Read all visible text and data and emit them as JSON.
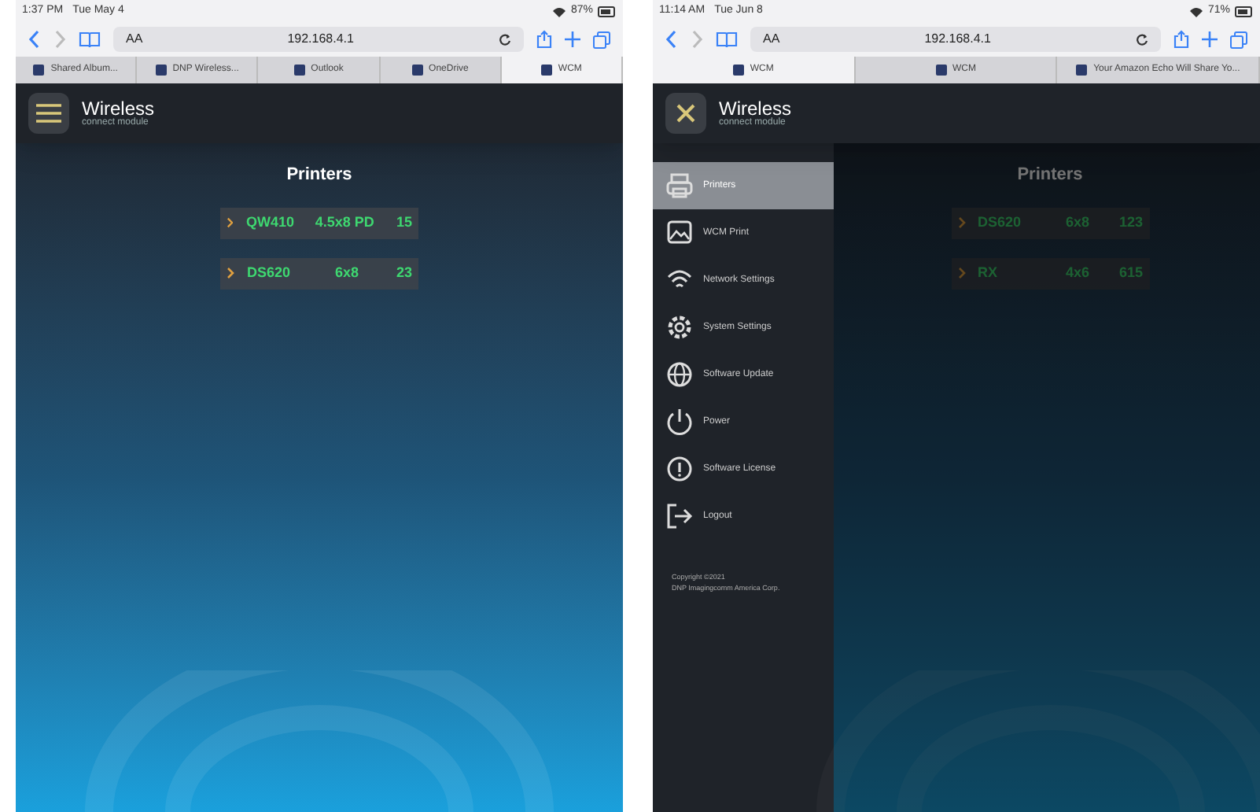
{
  "screens": [
    {
      "status_bar": {
        "time": "1:37 PM",
        "date": "Tue May 4",
        "battery": "87%"
      },
      "address_bar": {
        "text_size": "AA",
        "url": "192.168.4.1"
      },
      "tabs": [
        {
          "label": "Shared Album...",
          "selected": false
        },
        {
          "label": "DNP Wireless...",
          "selected": false
        },
        {
          "label": "Outlook",
          "selected": false
        },
        {
          "label": "OneDrive",
          "selected": false
        },
        {
          "label": "WCM",
          "selected": true
        }
      ],
      "header": {
        "logo": "Wireless",
        "logo_subtitle": "connect module",
        "menu_open": false
      },
      "title": "Printers",
      "printers": [
        {
          "model": "QW410",
          "size": "4.5x8 PD",
          "count": "15"
        },
        {
          "model": "DS620",
          "size": "6x8",
          "count": "23"
        }
      ]
    },
    {
      "status_bar": {
        "time": "11:14 AM",
        "date": "Tue Jun 8",
        "battery": "71%"
      },
      "address_bar": {
        "text_size": "AA",
        "url": "192.168.4.1"
      },
      "tabs": [
        {
          "label": "WCM",
          "selected": true
        },
        {
          "label": "WCM",
          "selected": false
        },
        {
          "label": "Your Amazon Echo Will Share Yo...",
          "selected": false
        }
      ],
      "header": {
        "logo": "Wireless",
        "logo_subtitle": "connect module",
        "menu_open": true
      },
      "title": "Printers",
      "printers": [
        {
          "model": "DS620",
          "size": "6x8",
          "count": "123"
        },
        {
          "model": "RX",
          "size": "4x6",
          "count": "615"
        }
      ],
      "sidebar": {
        "items": [
          {
            "label": "Printers",
            "kind": "printer",
            "selected": true
          },
          {
            "label": "WCM Print",
            "kind": "photo",
            "selected": false
          },
          {
            "label": "Network Settings",
            "kind": "wifi",
            "selected": false
          },
          {
            "label": "System Settings",
            "kind": "gear",
            "selected": false
          },
          {
            "label": "Software Update",
            "kind": "globe",
            "selected": false
          },
          {
            "label": "Power",
            "kind": "power",
            "selected": false
          },
          {
            "label": "Software License",
            "kind": "info",
            "selected": false
          },
          {
            "label": "Logout",
            "kind": "logout",
            "selected": false
          }
        ],
        "copyright": [
          "Copyright ©2021",
          "DNP Imagingcomm America Corp."
        ]
      }
    }
  ]
}
